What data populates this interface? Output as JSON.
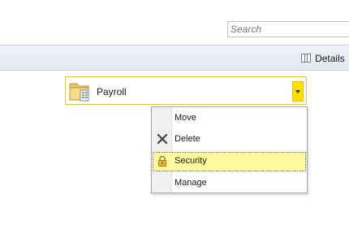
{
  "search": {
    "placeholder": "Search",
    "value": ""
  },
  "toolbar": {
    "details_label": "Details",
    "details_icon": "details-pane-icon"
  },
  "folder_selector": {
    "label": "Payroll",
    "icon": "folder-document-icon",
    "dropdown_icon": "chevron-down-icon",
    "accent_color": "#ffe000"
  },
  "context_menu": {
    "items": [
      {
        "label": "Move",
        "icon": ""
      },
      {
        "label": "Delete",
        "icon": "delete-x-icon"
      },
      {
        "label": "Security",
        "icon": "padlock-icon",
        "selected": true
      },
      {
        "label": "Manage",
        "icon": ""
      }
    ],
    "selection_color": "#fffaa0"
  }
}
